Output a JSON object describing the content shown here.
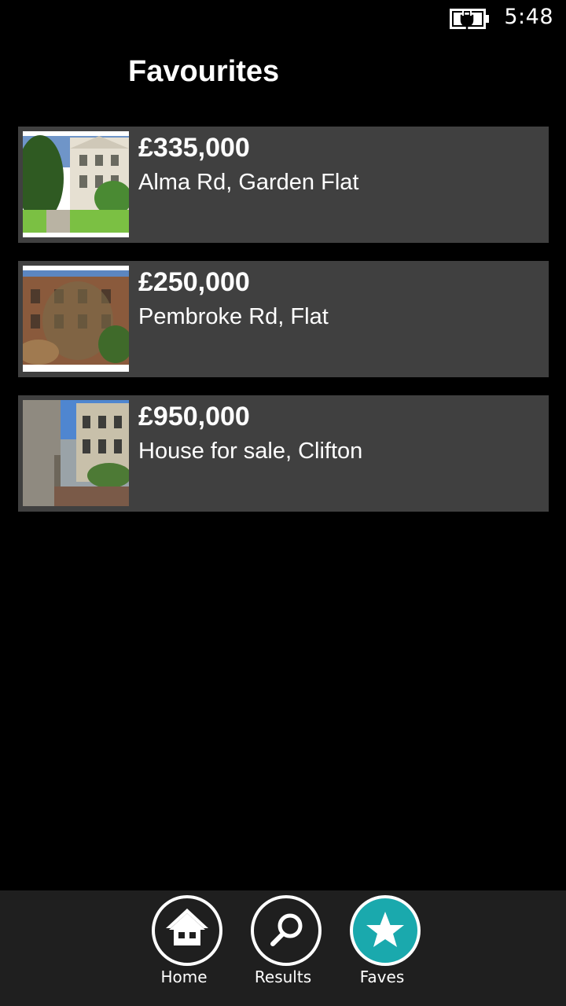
{
  "status_bar": {
    "time": "5:48",
    "battery_icon": "battery-charging-icon"
  },
  "page": {
    "title": "Favourites"
  },
  "favourites": [
    {
      "price": "£335,000",
      "address": "Alma Rd, Garden Flat",
      "thumbnail": "house-photo-icon"
    },
    {
      "price": "£250,000",
      "address": "Pembroke Rd, Flat",
      "thumbnail": "house-photo-icon"
    },
    {
      "price": "£950,000",
      "address": "House for sale, Clifton",
      "thumbnail": "house-photo-icon"
    }
  ],
  "app_bar": {
    "buttons": [
      {
        "label": "Home",
        "icon": "home-icon",
        "active": false
      },
      {
        "label": "Results",
        "icon": "search-icon",
        "active": false
      },
      {
        "label": "Faves",
        "icon": "star-icon",
        "active": true
      }
    ]
  },
  "colors": {
    "background": "#000000",
    "item_background": "#404040",
    "app_bar_background": "#1f1f1f",
    "accent": "#1aa9ad"
  }
}
